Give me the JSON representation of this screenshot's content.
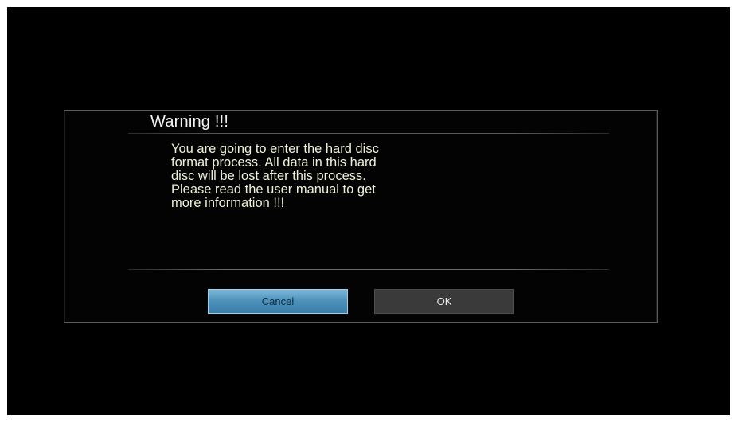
{
  "dialog": {
    "title": "Warning !!!",
    "message_lines": [
      "You are going to enter the hard disc",
      "format process. All data in this hard",
      "disc will be lost after this process.",
      "Please read the user manual to get",
      "more information !!!"
    ],
    "buttons": {
      "cancel_label": "Cancel",
      "ok_label": "OK"
    },
    "focused_button": "Cancel"
  },
  "colors": {
    "background": "#000000",
    "focused_button": "#4f93bd",
    "unfocused_button": "#3a3a3a",
    "message_text": "#f0f0d8"
  }
}
